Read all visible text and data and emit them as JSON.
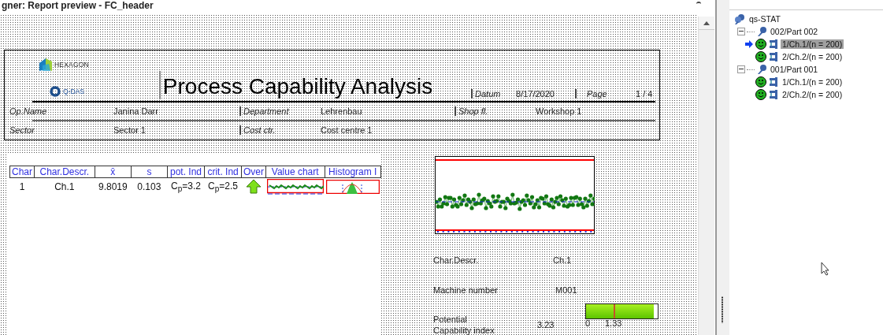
{
  "window": {
    "title": "gner: Report preview - FC_header"
  },
  "header": {
    "brand": "HEXAGON",
    "sub_brand": "Q-DAS",
    "title": "Process Capability Analysis",
    "date_label": "Datum",
    "date": "8/17/2020",
    "page_label": "Page",
    "page": "1 / 4",
    "fields": [
      {
        "label": "Op.Name",
        "value": "Janina Darr"
      },
      {
        "label": "Department",
        "value": "Lehrenbau"
      },
      {
        "label": "Shop fl.",
        "value": "Workshop 1"
      },
      {
        "label": "Sector",
        "value": "Sector 1"
      },
      {
        "label": "Cost ctr.",
        "value": "Cost centre 1"
      }
    ]
  },
  "table": {
    "columns": [
      "Char",
      "Char.Descr.",
      "x̄",
      "s",
      "pot. Ind",
      "crit. Ind",
      "Over",
      "Value chart",
      "Histogram I"
    ],
    "rows": [
      {
        "cells": [
          "1",
          "Ch.1",
          "9.8019",
          "0.103",
          "C$_{p}$=3.2",
          "C$_{p}$=2.5"
        ],
        "rising": true
      }
    ]
  },
  "details": [
    {
      "label": "Char.Descr.",
      "value": "Ch.1"
    },
    {
      "label": "Machine number",
      "value": "M001"
    }
  ],
  "capability": {
    "label": "Potential Capability index",
    "value": "3.23",
    "level": 0.94,
    "scale_min": "0",
    "scale_mark": "1.33"
  },
  "tree": {
    "label": "qs-STAT",
    "children": [
      {
        "label": "002/Part 002",
        "expanded": true,
        "children": [
          {
            "label": "1/Ch.1/(n = 200)",
            "selected": true,
            "current": true
          },
          {
            "label": "2/Ch.2/(n = 200)",
            "selected": false,
            "current": false
          }
        ]
      },
      {
        "label": "001/Part 001",
        "expanded": true,
        "children": [
          {
            "label": "1/Ch.1/(n = 200)",
            "selected": false,
            "current": false
          },
          {
            "label": "2/Ch.2/(n = 200)",
            "selected": false,
            "current": false
          }
        ]
      }
    ]
  }
}
